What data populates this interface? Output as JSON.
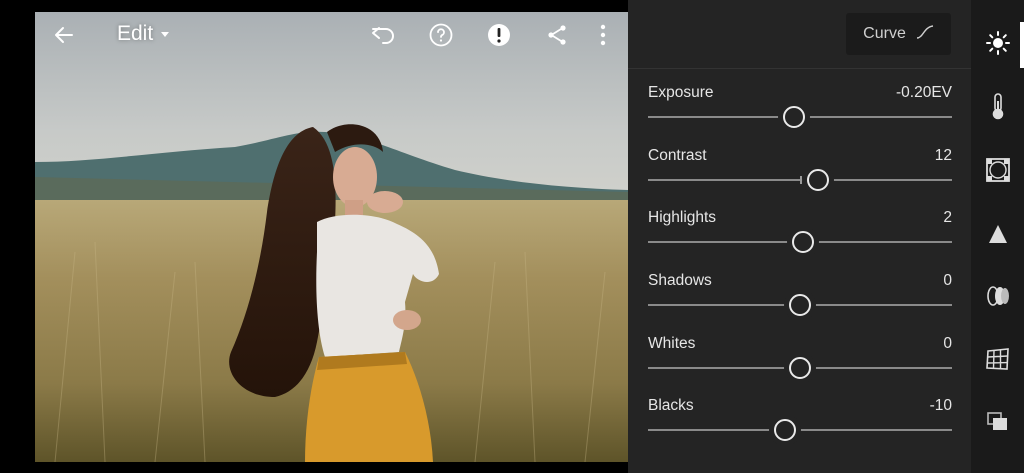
{
  "topbar": {
    "back_icon": "arrow-left-icon",
    "edit_label": "Edit",
    "edit_dropdown_icon": "caret-down-icon",
    "undo_icon": "undo-icon",
    "help_icon": "help-circle-icon",
    "alert_icon": "alert-circle-icon",
    "share_icon": "share-icon",
    "more_icon": "more-vertical-icon"
  },
  "panel": {
    "curve_label": "Curve",
    "curve_icon": "tone-curve-icon",
    "sliders": [
      {
        "label": "Exposure",
        "value": "-0.20EV",
        "position": 0.48
      },
      {
        "label": "Contrast",
        "value": "12",
        "position": 0.56
      },
      {
        "label": "Highlights",
        "value": "2",
        "position": 0.51
      },
      {
        "label": "Shadows",
        "value": "0",
        "position": 0.5
      },
      {
        "label": "Whites",
        "value": "0",
        "position": 0.5
      },
      {
        "label": "Blacks",
        "value": "-10",
        "position": 0.45
      }
    ]
  },
  "rail": {
    "items": [
      {
        "name": "light-icon",
        "active": true
      },
      {
        "name": "color-temperature-icon",
        "active": false
      },
      {
        "name": "effects-vignette-icon",
        "active": false
      },
      {
        "name": "detail-icon",
        "active": false
      },
      {
        "name": "optics-icon",
        "active": false
      },
      {
        "name": "geometry-icon",
        "active": false
      },
      {
        "name": "presets-icon",
        "active": false
      }
    ]
  }
}
